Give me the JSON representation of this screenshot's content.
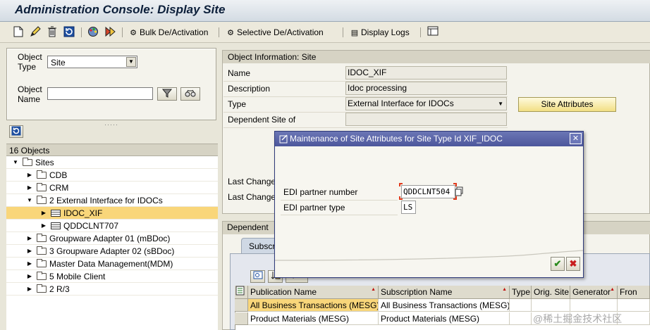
{
  "window": {
    "title": "Administration Console: Display Site"
  },
  "toolbar": {
    "icons": [
      "new-icon",
      "edit-icon",
      "delete-icon",
      "refresh-icon",
      "palette-icon",
      "activate-icon"
    ],
    "bulk_label": "Bulk De/Activation",
    "selective_label": "Selective De/Activation",
    "logs_label": "Display Logs"
  },
  "search": {
    "object_type_label_1": "Object",
    "object_type_label_2": "Type",
    "object_type_value": "Site",
    "object_name_label_1": "Object",
    "object_name_label_2": "Name",
    "object_name_value": ""
  },
  "tree": {
    "count_label": "16 Objects",
    "rows": [
      {
        "label": "Sites",
        "level": 0,
        "expanded": true,
        "kind": "folder"
      },
      {
        "label": "CDB",
        "level": 1,
        "expanded": false,
        "kind": "folder"
      },
      {
        "label": "CRM",
        "level": 1,
        "expanded": false,
        "kind": "folder"
      },
      {
        "label": "2 External Interface for IDOCs",
        "level": 1,
        "expanded": true,
        "kind": "folder"
      },
      {
        "label": "IDOC_XIF",
        "level": 2,
        "expanded": false,
        "kind": "node",
        "selected": true
      },
      {
        "label": "QDDCLNT707",
        "level": 2,
        "expanded": false,
        "kind": "node"
      },
      {
        "label": "Groupware Adapter 01 (mBDoc)",
        "level": 1,
        "expanded": false,
        "kind": "folder"
      },
      {
        "label": "3 Groupware Adapter 02 (sBDoc)",
        "level": 1,
        "expanded": false,
        "kind": "folder"
      },
      {
        "label": "Master Data Management(MDM)",
        "level": 1,
        "expanded": false,
        "kind": "folder"
      },
      {
        "label": "5 Mobile Client",
        "level": 1,
        "expanded": false,
        "kind": "folder"
      },
      {
        "label": "2 R/3",
        "level": 1,
        "expanded": false,
        "kind": "folder"
      }
    ]
  },
  "object_info": {
    "header": "Object Information: Site",
    "name_label": "Name",
    "name_value": "IDOC_XIF",
    "description_label": "Description",
    "description_value": "Idoc processing",
    "type_label": "Type",
    "type_value": "External Interface for IDOCs",
    "dependent_label": "Dependent Site of",
    "dependent_value": "",
    "last_change_1": "Last Change",
    "last_change_2": "Last Change",
    "site_attributes_button": "Site Attributes"
  },
  "dependent": {
    "header": "Dependent",
    "tab_label": "Subscr",
    "columns": [
      "Publication Name",
      "Subscription Name",
      "Type",
      "Orig. Site",
      "Generator",
      "Fron"
    ],
    "rows": [
      [
        "All Business Transactions (MESG)",
        "All Business Transactions (MESG)",
        "",
        "",
        "",
        ""
      ],
      [
        "Product Materials (MESG)",
        "Product Materials (MESG)",
        "",
        "",
        "",
        ""
      ]
    ]
  },
  "dialog": {
    "title": "Maintenance of Site Attributes for Site Type Id XIF_IDOC",
    "edi_number_label": "EDI partner number",
    "edi_number_value": "QDDCLNT504",
    "edi_type_label": "EDI partner type",
    "edi_type_value": "LS"
  },
  "watermark": "@稀土掘金技术社区",
  "colors": {
    "selection": "#f9d67a",
    "dialog_title": "#4d579c",
    "accent_button": "#f2df84",
    "sort_arrow": "#c01515"
  }
}
